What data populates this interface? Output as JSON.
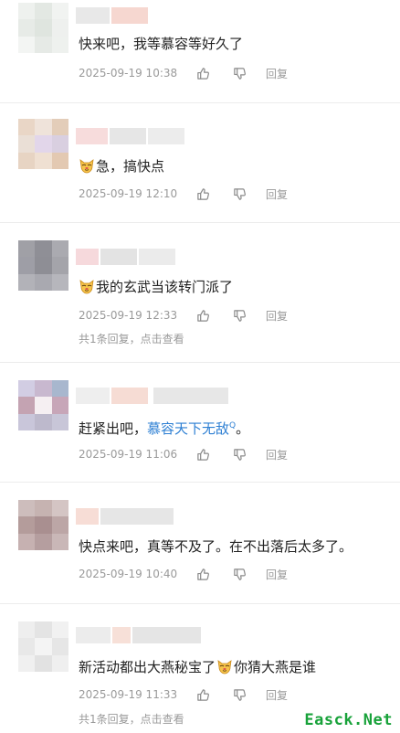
{
  "colors": {
    "link": "#2d7fd3",
    "meta": "#9a9a9a",
    "watermark": "#18a23a"
  },
  "comments": [
    {
      "text": "快来吧，我等慕容等好久了",
      "date": "2025-09-19 10:38",
      "reply_label": "回复",
      "avatar_colors": [
        "#eef1ee",
        "#e3e8e3",
        "#f1f3f1",
        "#e7ebe7",
        "#dfe5df",
        "#eef0ee",
        "#f3f5f3",
        "#e6eae6",
        "#eef1ee"
      ],
      "name_blocks": [
        "#e8e8e8",
        "#f6d7d0"
      ]
    },
    {
      "emoji": "cat-emoji",
      "text": "急，搞快点",
      "date": "2025-09-19 12:10",
      "reply_label": "回复",
      "avatar_colors": [
        "#e9d6c6",
        "#efe3da",
        "#e3cdb9",
        "#eadfd6",
        "#e2d6ea",
        "#d9cfe0",
        "#e7d4c3",
        "#efe0d2",
        "#e3c9b2"
      ],
      "name_blocks": [
        "#f7dcdc",
        "#e6e6e6",
        "#ececec"
      ]
    },
    {
      "emoji": "cat-emoji",
      "text": "我的玄武当该转门派了",
      "date": "2025-09-19 12:33",
      "reply_label": "回复",
      "replies_text": "共1条回复，点击查看",
      "avatar_colors": [
        "#a0a0a6",
        "#8f8f96",
        "#aaaab0",
        "#9e9ea6",
        "#8e8e95",
        "#a4a4aa",
        "#b2b2b8",
        "#a9a9b0",
        "#b6b6bc"
      ],
      "name_blocks": [
        "#f6d9dc",
        "#e3e3e3",
        "#ebebeb"
      ]
    },
    {
      "text_before": "赶紧出吧，",
      "link": "慕容天下无敌",
      "link_sup": "Q",
      "text_after": "。",
      "date": "2025-09-19 11:06",
      "reply_label": "回复",
      "avatar_colors": [
        "#d2cde3",
        "#c8b8cf",
        "#a8b7ce",
        "#c4a3b2",
        "#f5eff2",
        "#c7a6b8",
        "#c9c6da",
        "#bdb9cc",
        "#c8c6d8"
      ],
      "name_blocks": [
        "#eeeeee",
        "#f6dcd4",
        "#e7e7e7"
      ]
    },
    {
      "text": "快点来吧，真等不及了。在不出落后太多了。",
      "date": "2025-09-19 10:40",
      "reply_label": "回复",
      "avatar_colors": [
        "#cdbdbc",
        "#c6b3b1",
        "#d4c5c4",
        "#b49c9b",
        "#a98f90",
        "#bca6a6",
        "#c6b1b1",
        "#b59e9f",
        "#c9b7b7"
      ],
      "name_blocks": [
        "#f7ddd6",
        "#e6e6e6"
      ]
    },
    {
      "text_before": "新活动都出大燕秘宝了",
      "emoji_inline": "cat-emoji",
      "text_after": "你猜大燕是谁",
      "date": "2025-09-19 11:33",
      "reply_label": "回复",
      "replies_text": "共1条回复，点击查看",
      "avatar_colors": [
        "#eeeeee",
        "#e4e4e4",
        "#f1f1f1",
        "#e8e8e8",
        "#f4f4f4",
        "#e6e6e6",
        "#f0f0f0",
        "#e2e2e2",
        "#efefef"
      ],
      "name_blocks": [
        "#ececec",
        "#f7e0d8",
        "#e5e5e5"
      ]
    }
  ],
  "watermark": "Easck.Net"
}
